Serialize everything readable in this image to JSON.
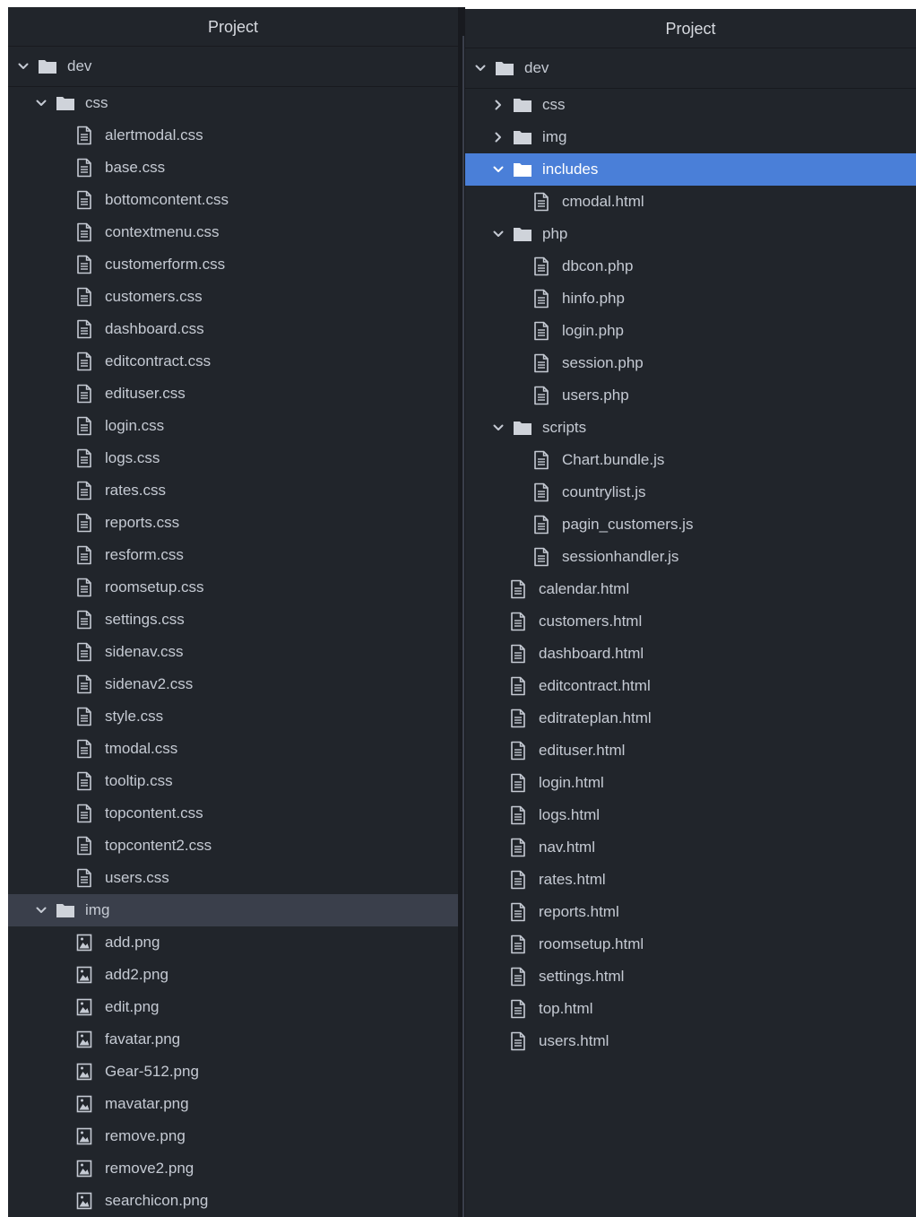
{
  "colors": {
    "panel_bg": "#21252b",
    "selected_bg": "#4a7fd8",
    "highlight_bg": "#3a3f4b",
    "text": "#c5cad3",
    "folder_icon": "#cfd3da"
  },
  "left_panel": {
    "title": "Project",
    "root": {
      "label": "dev",
      "expanded": true
    },
    "css_folder": {
      "label": "css",
      "expanded": true
    },
    "css_files": [
      "alertmodal.css",
      "base.css",
      "bottomcontent.css",
      "contextmenu.css",
      "customerform.css",
      "customers.css",
      "dashboard.css",
      "editcontract.css",
      "edituser.css",
      "login.css",
      "logs.css",
      "rates.css",
      "reports.css",
      "resform.css",
      "roomsetup.css",
      "settings.css",
      "sidenav.css",
      "sidenav2.css",
      "style.css",
      "tmodal.css",
      "tooltip.css",
      "topcontent.css",
      "topcontent2.css",
      "users.css"
    ],
    "img_folder": {
      "label": "img",
      "expanded": true,
      "highlighted": true
    },
    "img_files": [
      "add.png",
      "add2.png",
      "edit.png",
      "favatar.png",
      "Gear-512.png",
      "mavatar.png",
      "remove.png",
      "remove2.png",
      "searchicon.png"
    ]
  },
  "right_panel": {
    "title": "Project",
    "root": {
      "label": "dev",
      "expanded": true
    },
    "css_folder": {
      "label": "css",
      "expanded": false
    },
    "img_folder": {
      "label": "img",
      "expanded": false
    },
    "includes_folder": {
      "label": "includes",
      "expanded": true,
      "selected": true
    },
    "includes_files": [
      "cmodal.html"
    ],
    "php_folder": {
      "label": "php",
      "expanded": true
    },
    "php_files": [
      "dbcon.php",
      "hinfo.php",
      "login.php",
      "session.php",
      "users.php"
    ],
    "scripts_folder": {
      "label": "scripts",
      "expanded": true
    },
    "scripts_files": [
      "Chart.bundle.js",
      "countrylist.js",
      "pagin_customers.js",
      "sessionhandler.js"
    ],
    "root_files": [
      "calendar.html",
      "customers.html",
      "dashboard.html",
      "editcontract.html",
      "editrateplan.html",
      "edituser.html",
      "login.html",
      "logs.html",
      "nav.html",
      "rates.html",
      "reports.html",
      "roomsetup.html",
      "settings.html",
      "top.html",
      "users.html"
    ]
  }
}
